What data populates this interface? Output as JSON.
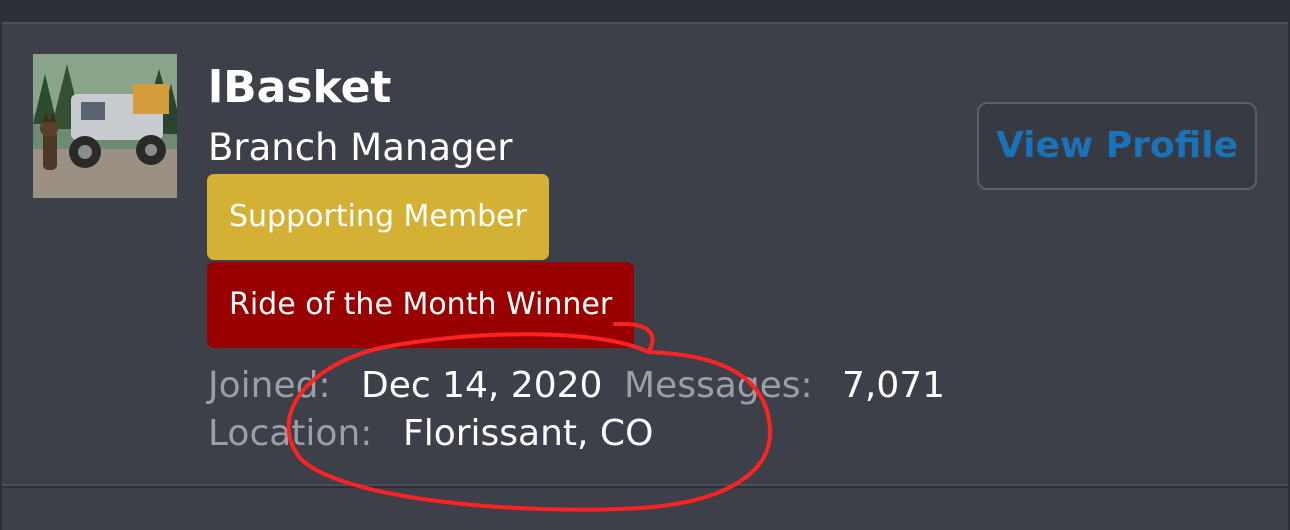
{
  "member": {
    "username": "lBasket",
    "title": "Branch Manager",
    "banners": [
      "Supporting Member",
      "Ride of the Month Winner"
    ],
    "stats": {
      "joined_label": "Joined:",
      "joined_value": "Dec 14, 2020",
      "messages_label": "Messages:",
      "messages_value": "7,071",
      "location_label": "Location:",
      "location_value": "Florissant, CO"
    }
  },
  "actions": {
    "view_profile_label": "View Profile"
  },
  "colors": {
    "card_background": "#3d4049",
    "supporting_banner": "#d4b034",
    "ride_banner": "#990000",
    "link_blue": "#1a73b8",
    "annotation_red": "#ff2222"
  }
}
